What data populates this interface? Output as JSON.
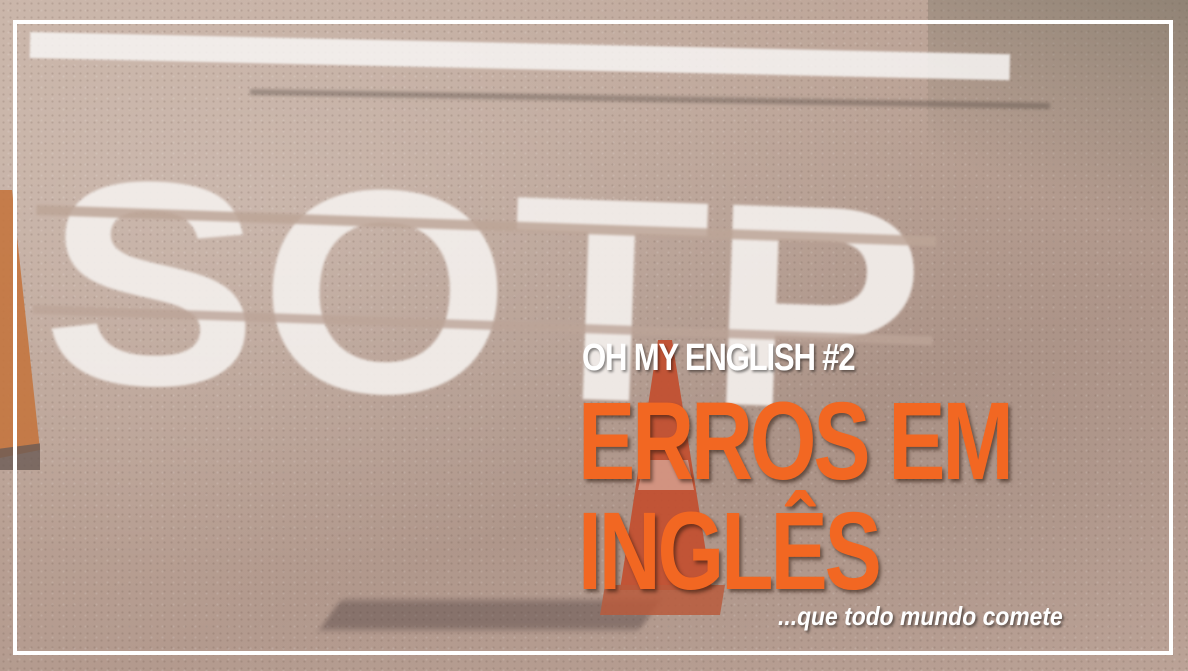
{
  "overlay": {
    "kicker": "OH MY ENGLISH #2",
    "headline_line1": "ERROS EM",
    "headline_line2": "INGLÊS",
    "tagline": "...que todo mundo comete"
  },
  "photo": {
    "road_marking_text": "SOTP"
  },
  "colors": {
    "headline": "#f26722",
    "kicker": "#ffffff",
    "frame": "#ffffff",
    "pavement": "#bca497"
  }
}
